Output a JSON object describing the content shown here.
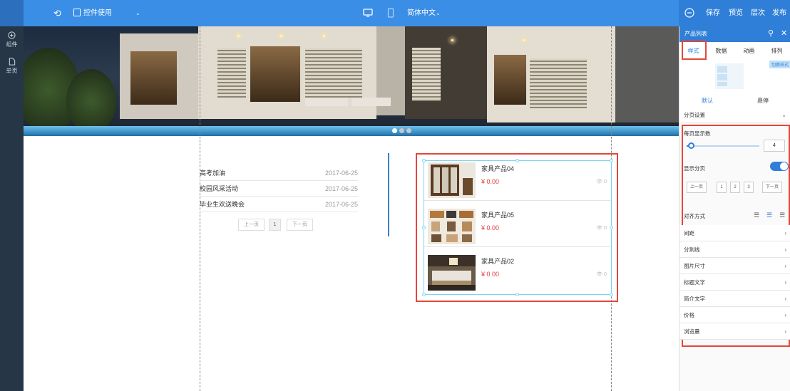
{
  "toolbar": {
    "undo_icon": "undo-icon",
    "page_label": "控件使用",
    "language": "简体中文",
    "save": "保存",
    "preview": "预览",
    "layers": "层次",
    "publish": "发布"
  },
  "rail": {
    "components": "组件",
    "pages": "单页"
  },
  "news": {
    "items": [
      {
        "title": "高考加油",
        "date": "2017-06-25"
      },
      {
        "title": "校园风采活动",
        "date": "2017-06-25"
      },
      {
        "title": "毕业生欢送晚会",
        "date": "2017-06-25"
      }
    ],
    "prev": "上一页",
    "page": "1",
    "next": "下一页"
  },
  "products": {
    "items": [
      {
        "name": "家具产品04",
        "price": "¥ 0.00",
        "views": "0"
      },
      {
        "name": "家具产品05",
        "price": "¥ 0.00",
        "views": "0"
      },
      {
        "name": "家具产品02",
        "price": "¥ 0.00",
        "views": "0"
      }
    ]
  },
  "panel": {
    "title": "产品列表",
    "tabs": [
      "样式",
      "数据",
      "动画",
      "排列"
    ],
    "switch_tag": "切换样式",
    "state_tabs": [
      "默认",
      "悬停"
    ],
    "paging_settings": "分页设置",
    "per_page_label": "每页显示数",
    "per_page_value": "4",
    "per_page_fraction": 0.06,
    "show_paging_label": "显示分页",
    "show_paging_on": true,
    "pager_buttons": [
      "上一页",
      "1",
      "2",
      "3",
      "下一页"
    ],
    "align_label": "对齐方式",
    "sections": [
      "间距",
      "分割线",
      "图片尺寸",
      "标题文字",
      "简介文字",
      "价格",
      "浏览量"
    ]
  },
  "colors": {
    "accent": "#2f7fd8",
    "highlight": "#e2473a",
    "price": "#e23c3c"
  }
}
